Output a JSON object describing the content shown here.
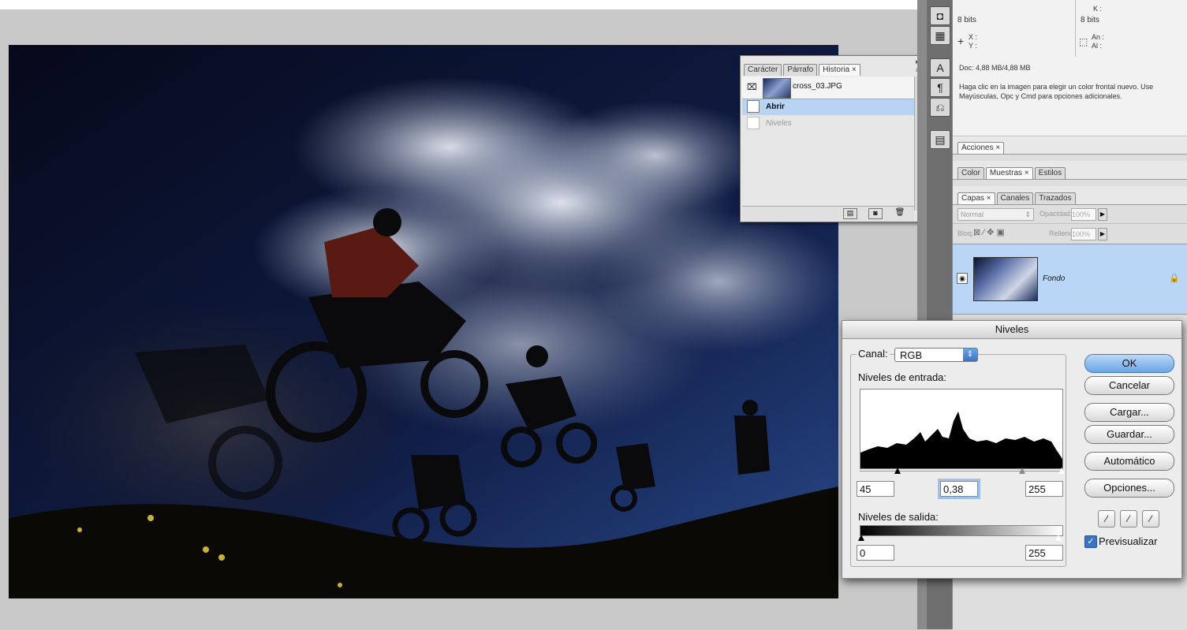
{
  "info": {
    "bits_left": "8 bits",
    "k_label": "K :",
    "bits_right": "8 bits",
    "x_label": "X :",
    "y_label": "Y :",
    "an_label": "An :",
    "al_label": "Al :",
    "doc": "Doc: 4,88 MB/4,88 MB",
    "hint": "Haga clic en la imagen para elegir un color frontal nuevo. Use Mayúsculas, Opc y Cmd para opciones adicionales."
  },
  "history_panel": {
    "tabs": [
      "Carácter",
      "Párrafo",
      "Historia ×"
    ],
    "snapshot": "cross_03.JPG",
    "steps": [
      "Abrir",
      "Niveles"
    ]
  },
  "right_panels": {
    "acciones_tab": "Acciones ×",
    "color_tabs": [
      "Color",
      "Muestras ×",
      "Estilos"
    ],
    "layer_tabs": [
      "Capas ×",
      "Canales",
      "Trazados"
    ],
    "blend_mode": "Normal",
    "opacity_label": "Opacidad:",
    "opacity_value": "100%",
    "lock_label": "Bloq.:",
    "fill_label": "Relleno:",
    "fill_value": "100%",
    "layer_name": "Fondo"
  },
  "levels_dialog": {
    "title": "Niveles",
    "channel_label": "Canal:",
    "channel_value": "RGB",
    "input_label": "Niveles de entrada:",
    "input_black": "45",
    "input_gamma": "0,38",
    "input_white": "255",
    "output_label": "Niveles de salida:",
    "output_black": "0",
    "output_white": "255",
    "buttons": {
      "ok": "OK",
      "cancel": "Cancelar",
      "load": "Cargar...",
      "save": "Guardar...",
      "auto": "Automático",
      "options": "Opciones..."
    },
    "preview_label": "Previsualizar",
    "preview_checked": true
  }
}
